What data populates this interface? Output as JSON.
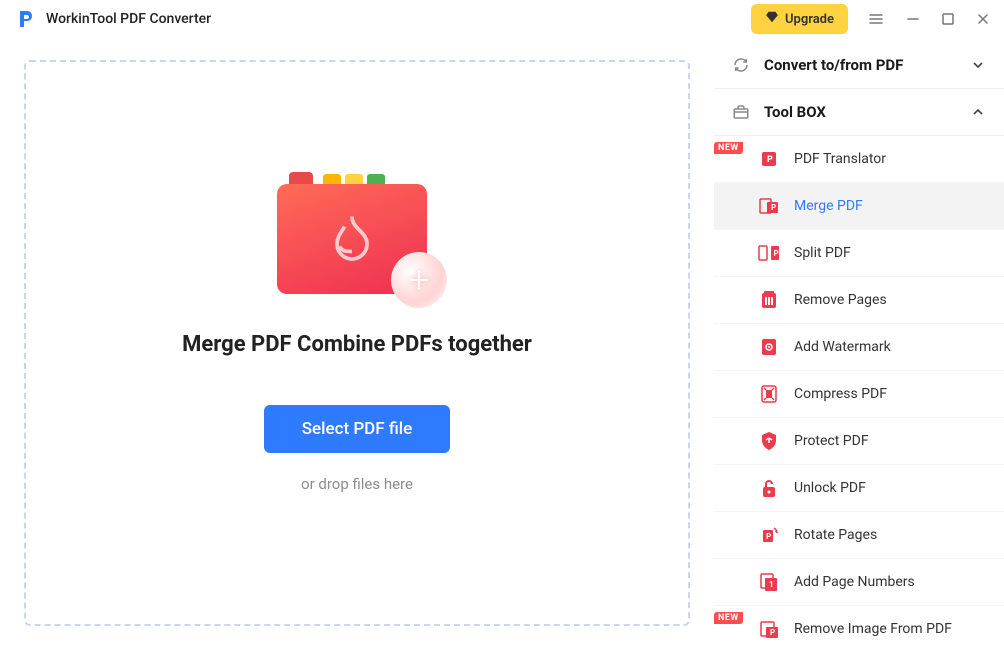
{
  "titlebar": {
    "app_title": "WorkinTool PDF Converter",
    "upgrade_label": "Upgrade"
  },
  "main": {
    "heading": "Merge PDF Combine PDFs together",
    "select_button": "Select PDF file",
    "drop_hint": "or drop files here"
  },
  "sidebar": {
    "sections": [
      {
        "id": "convert",
        "title": "Convert to/from PDF",
        "expanded": false
      },
      {
        "id": "toolbox",
        "title": "Tool BOX",
        "expanded": true
      }
    ],
    "toolbox_items": [
      {
        "id": "pdf-translator",
        "label": "PDF Translator",
        "badge": "NEW",
        "icon": "translator",
        "active": false
      },
      {
        "id": "merge-pdf",
        "label": "Merge PDF",
        "icon": "merge",
        "active": true
      },
      {
        "id": "split-pdf",
        "label": "Split PDF",
        "icon": "split",
        "active": false
      },
      {
        "id": "remove-pages",
        "label": "Remove Pages",
        "icon": "remove-pages",
        "active": false
      },
      {
        "id": "add-watermark",
        "label": "Add Watermark",
        "icon": "watermark",
        "active": false
      },
      {
        "id": "compress-pdf",
        "label": "Compress PDF",
        "icon": "compress",
        "active": false
      },
      {
        "id": "protect-pdf",
        "label": "Protect PDF",
        "icon": "protect",
        "active": false
      },
      {
        "id": "unlock-pdf",
        "label": "Unlock PDF",
        "icon": "unlock",
        "active": false
      },
      {
        "id": "rotate-pages",
        "label": "Rotate Pages",
        "icon": "rotate",
        "active": false
      },
      {
        "id": "add-page-numbers",
        "label": "Add Page Numbers",
        "icon": "page-numbers",
        "active": false
      },
      {
        "id": "remove-image",
        "label": "Remove Image From PDF",
        "badge": "NEW",
        "icon": "remove-image",
        "active": false
      }
    ]
  },
  "colors": {
    "accent": "#2f7bff",
    "danger": "#ff4d4d",
    "upgrade_bg": "#ffd23f",
    "pdf_red": "#ef2e52"
  }
}
